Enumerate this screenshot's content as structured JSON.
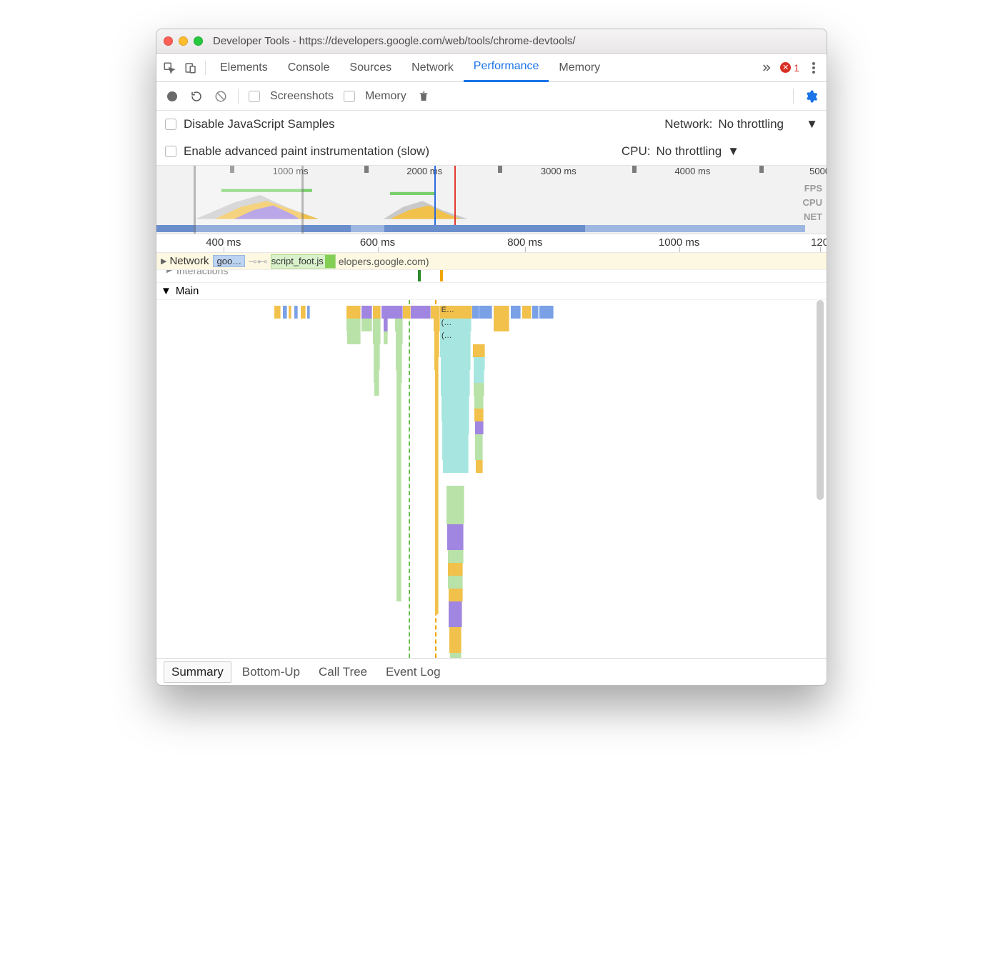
{
  "window": {
    "title": "Developer Tools - https://developers.google.com/web/tools/chrome-devtools/"
  },
  "tabs": {
    "items": [
      "Elements",
      "Console",
      "Sources",
      "Network",
      "Performance",
      "Memory"
    ],
    "active": 4,
    "overflow_count": "1"
  },
  "toolbar": {
    "screenshots_label": "Screenshots",
    "memory_label": "Memory"
  },
  "options": {
    "disable_js_label": "Disable JavaScript Samples",
    "advanced_paint_label": "Enable advanced paint instrumentation (slow)",
    "network_label": "Network:",
    "network_value": "No throttling",
    "cpu_label": "CPU:",
    "cpu_value": "No throttling"
  },
  "overview": {
    "ruler": [
      "1000 ms",
      "2000 ms",
      "3000 ms",
      "4000 ms",
      "5000"
    ],
    "ruler_pos_pct": [
      20,
      40,
      60,
      80,
      99
    ],
    "labels": [
      "FPS",
      "CPU",
      "NET"
    ],
    "zoom_start_pct": 5.5,
    "zoom_end_pct": 22,
    "markers": [
      {
        "pos_pct": 41.5,
        "color": "#2b6ae0"
      },
      {
        "pos_pct": 44.5,
        "color": "#e23a2f"
      }
    ],
    "net_segments": [
      {
        "start_pct": 0,
        "width_pct": 29
      },
      {
        "start_pct": 34,
        "width_pct": 30
      }
    ]
  },
  "detail_ruler": {
    "labels": [
      "400 ms",
      "600 ms",
      "800 ms",
      "1000 ms",
      "120"
    ],
    "pos_pct": [
      10,
      33,
      55,
      78,
      99
    ]
  },
  "tracks": {
    "network_label": "Network",
    "network_item1": "goo…",
    "network_item2": "script_foot.js",
    "network_item3": "elopers.google.com)",
    "interactions_label": "Interactions",
    "main_label": "Main"
  },
  "flame": {
    "dashes": [
      {
        "pos_pct": 38.5,
        "color": "#6bbf4f"
      },
      {
        "pos_pct": 42.5,
        "color": "#f1a500"
      }
    ],
    "topband": [
      {
        "x": 18,
        "w": 1.0,
        "c": "#f1c14b"
      },
      {
        "x": 19.3,
        "w": 0.6,
        "c": "#7aa0e6"
      },
      {
        "x": 20.1,
        "w": 0.5,
        "c": "#f1c14b"
      },
      {
        "x": 21,
        "w": 0.6,
        "c": "#7aa0e6"
      },
      {
        "x": 22,
        "w": 0.8,
        "c": "#f1c14b"
      },
      {
        "x": 23,
        "w": 0.4,
        "c": "#7aa0e6"
      },
      {
        "x": 29,
        "w": 2.2,
        "c": "#f1c14b"
      },
      {
        "x": 31.3,
        "w": 1.6,
        "c": "#a086e0"
      },
      {
        "x": 33,
        "w": 1.2,
        "c": "#f1c14b"
      },
      {
        "x": 34.3,
        "w": 3.3,
        "c": "#a086e0"
      },
      {
        "x": 37.6,
        "w": 1.2,
        "c": "#f1c14b"
      },
      {
        "x": 38.8,
        "w": 3.0,
        "c": "#a086e0"
      },
      {
        "x": 41.8,
        "w": 1.4,
        "c": "#f1c14b"
      },
      {
        "x": 43.2,
        "w": 5.0,
        "c": "#f1c14b",
        "t": "E…"
      },
      {
        "x": 48.2,
        "w": 1.0,
        "c": "#7aa0e6"
      },
      {
        "x": 49.2,
        "w": 2.0,
        "c": "#7aa0e6"
      },
      {
        "x": 51.4,
        "w": 2.4,
        "c": "#f1c14b"
      },
      {
        "x": 54,
        "w": 1.6,
        "c": "#7aa0e6"
      },
      {
        "x": 55.8,
        "w": 1.4,
        "c": "#f1c14b"
      },
      {
        "x": 57.3,
        "w": 1.0,
        "c": "#7aa0e6"
      },
      {
        "x": 58.4,
        "w": 2.2,
        "c": "#7aa0e6"
      }
    ],
    "stacks": [
      {
        "x": 29,
        "w": 2.2,
        "rows": [
          "#b9e2a8",
          "#b9e2a8"
        ]
      },
      {
        "x": 31.3,
        "w": 1.6,
        "rows": [
          "#b9e2a8"
        ]
      },
      {
        "x": 33,
        "w": 1.2,
        "rows": [
          "#b9e2a8",
          "#b9e2a8",
          "#b9e2a8",
          "#b9e2a8",
          "#b9e2a8",
          "#b9e2a8"
        ]
      },
      {
        "x": 34.6,
        "w": 0.7,
        "rows": [
          "#a086e0",
          "#b9e2a8"
        ]
      },
      {
        "x": 36.4,
        "w": 1.2,
        "rows": [
          "#b9e2a8",
          "#b9e2a8",
          "#b9e2a8",
          "#b9e2a8",
          "#b9e2a8",
          "#b9e2a8",
          "#b9e2a8",
          "#b9e2a8",
          "#b9e2a8",
          "#b9e2a8",
          "#b9e2a8",
          "#b9e2a8",
          "#b9e2a8",
          "#b9e2a8",
          "#b9e2a8",
          "#b9e2a8",
          "#b9e2a8",
          "#b9e2a8",
          "#b9e2a8",
          "#b9e2a8",
          "#b9e2a8",
          "#b9e2a8"
        ]
      },
      {
        "x": 43.2,
        "w": 4.8,
        "rows": [
          "#a7e6e0",
          "#a7e6e0",
          "#a7e6e0",
          "#a7e6e0",
          "#a7e6e0",
          "#a7e6e0",
          "#a7e6e0",
          "#a7e6e0",
          "#a7e6e0",
          "#a7e6e0",
          "#a7e6e0",
          "#a7e6e0"
        ],
        "labels": [
          "(…",
          "(…"
        ]
      },
      {
        "x": 44.2,
        "w": 2.8,
        "rows": [
          "#b9e2a8",
          "#b9e2a8",
          "#b9e2a8",
          "#a086e0",
          "#a086e0",
          "#b9e2a8",
          "#f1c14b",
          "#b9e2a8",
          "#f1c14b",
          "#a086e0",
          "#a086e0",
          "#f1c14b",
          "#f1c14b",
          "#b9e2a8",
          "#b9e2a8",
          "#b9e2a8",
          "#f1c14b",
          "#a086e0"
        ],
        "offset": 13
      },
      {
        "x": 48.3,
        "w": 1.8,
        "rows": [
          "#f1c14b",
          "#a7e6e0",
          "#a7e6e0",
          "#b9e2a8",
          "#b9e2a8",
          "#f1c14b",
          "#a086e0",
          "#b9e2a8",
          "#b9e2a8",
          "#f1c14b"
        ],
        "offset": 2
      },
      {
        "x": 51.4,
        "w": 2.4,
        "rows": [
          "#f1c14b"
        ]
      },
      {
        "x": 42.3,
        "w": 0.9,
        "rows": [
          "#f1c14b",
          "#f1c14b",
          "#f1c14b",
          "#f1c14b",
          "#f1c14b",
          "#f1c14b",
          "#f1c14b",
          "#f1c14b",
          "#f1c14b",
          "#f1c14b",
          "#f1c14b",
          "#f1c14b",
          "#f1c14b",
          "#f1c14b",
          "#f1c14b",
          "#f1c14b",
          "#f1c14b",
          "#f1c14b",
          "#f1c14b",
          "#f1c14b",
          "#f1c14b",
          "#f1c14b",
          "#f1c14b"
        ]
      }
    ]
  },
  "bottom_tabs": {
    "items": [
      "Summary",
      "Bottom-Up",
      "Call Tree",
      "Event Log"
    ],
    "active": 0
  }
}
